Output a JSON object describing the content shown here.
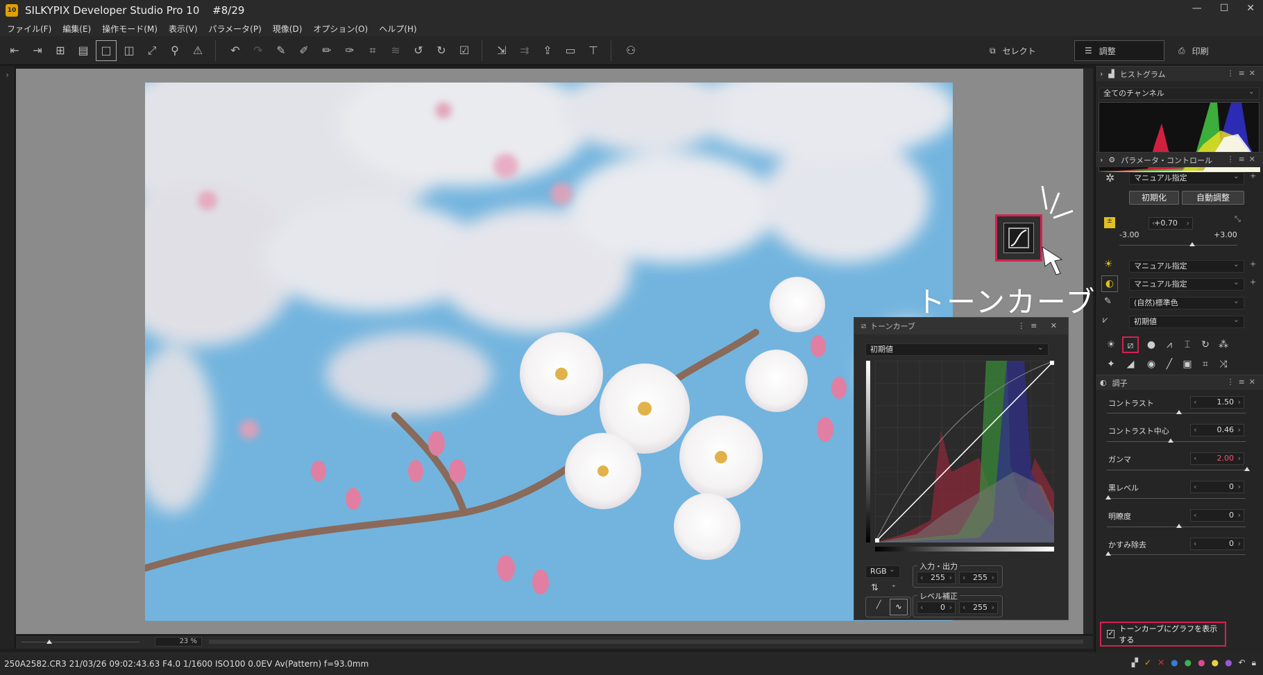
{
  "window": {
    "app_badge": "10",
    "title": "SILKYPIX Developer Studio Pro 10",
    "counter": "#8/29",
    "controls": [
      "—",
      "☐",
      "✕"
    ]
  },
  "menu": [
    "ファイル(F)",
    "編集(E)",
    "操作モード(M)",
    "表示(V)",
    "パラメータ(P)",
    "現像(D)",
    "オプション(O)",
    "ヘルプ(H)"
  ],
  "mode_tabs": [
    {
      "label": "セレクト",
      "icon": "select-icon"
    },
    {
      "label": "調整",
      "icon": "adjust-icon"
    },
    {
      "label": "印刷",
      "icon": "print-icon"
    }
  ],
  "callout": {
    "label": "トーンカーブ"
  },
  "tone_curve": {
    "title": "トーンカーブ",
    "preset": "初期値",
    "channel": "RGB",
    "io_legend": "入力・出力",
    "input": "255",
    "output": "255",
    "level_legend": "レベル補正",
    "level_low": "0",
    "level_high": "255"
  },
  "right_panel": {
    "histogram": {
      "title": "ヒストグラム",
      "channel": "全てのチャンネル"
    },
    "param_control": {
      "title": "パラメータ・コントロール",
      "preset": "マニュアル指定",
      "reset_button": "初期化",
      "auto_button": "自動調整",
      "exposure": "+0.70",
      "exposure_min": "-3.00",
      "exposure_max": "+3.00",
      "exposure_value": 0.7,
      "wb": "マニュアル指定",
      "tone": "マニュアル指定",
      "color": "(自然)標準色",
      "sharp": "初期値"
    },
    "tone_section": {
      "title": "調子",
      "items": [
        {
          "label": "コントラスト",
          "value": "1.50"
        },
        {
          "label": "コントラスト中心",
          "value": "0.46"
        },
        {
          "label": "ガンマ",
          "value": "2.00"
        },
        {
          "label": "黒レベル",
          "value": "0"
        },
        {
          "label": "明瞭度",
          "value": "0"
        },
        {
          "label": "かすみ除去",
          "value": "0"
        }
      ]
    },
    "checkbox": {
      "label": "トーンカーブにグラフを表示する",
      "checked": true
    }
  },
  "zoom": {
    "value": "23",
    "unit": "%"
  },
  "status": {
    "text": "250A2582.CR3 21/03/26 09:02:43.63 F4.0 1/1600 ISO100  0.0EV Av(Pattern) f=93.0mm"
  },
  "colors": {
    "accent": "#d62152",
    "background": "#1e1e1e"
  }
}
